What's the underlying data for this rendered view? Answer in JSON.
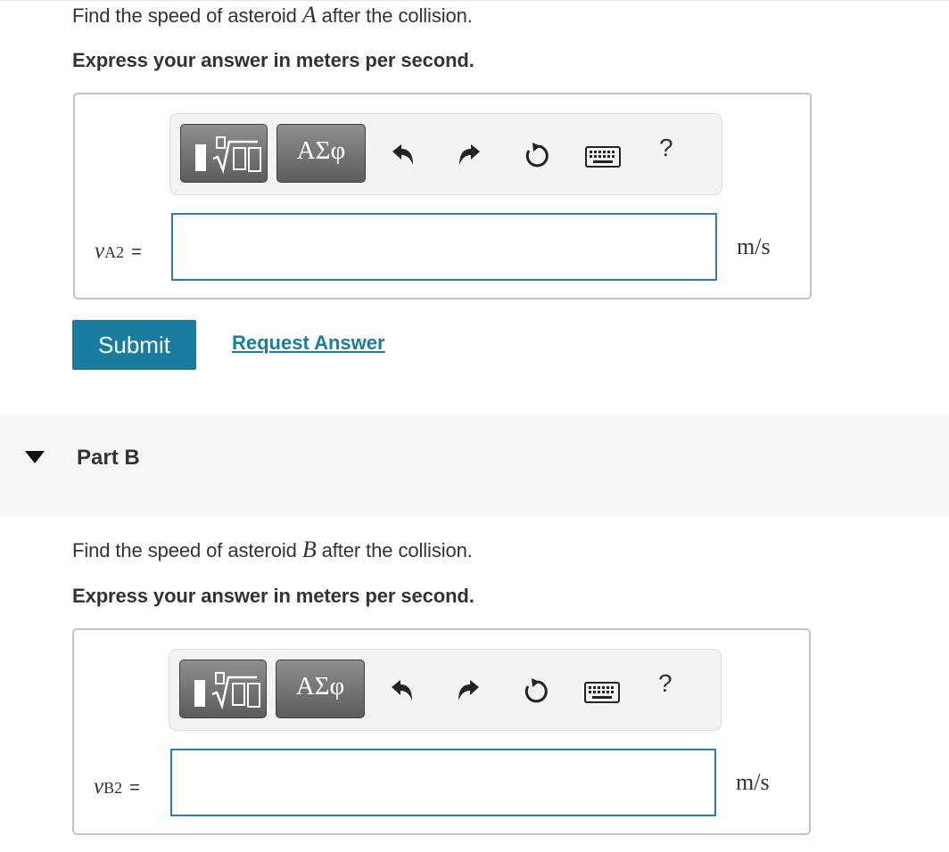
{
  "partA": {
    "prompt_before": "Find the speed of asteroid ",
    "prompt_var": "A",
    "prompt_after": " after the collision.",
    "instruction": "Express your answer in meters per second.",
    "variable": {
      "symbol": "v",
      "subscript": "A2",
      "equals": "="
    },
    "input": {
      "value": "",
      "placeholder": ""
    },
    "unit": "m/s",
    "submit_label": "Submit",
    "request_label": "Request Answer"
  },
  "toolbar": {
    "symbols_label": "ΑΣφ",
    "help_label": "?",
    "icons": [
      "templates-icon",
      "undo-icon",
      "redo-icon",
      "reset-icon",
      "keyboard-icon",
      "help-icon"
    ]
  },
  "partB_header": {
    "title": "Part B",
    "toggle_icon": "triangle-down-icon"
  },
  "partB": {
    "prompt_before": "Find the speed of asteroid ",
    "prompt_var": "B",
    "prompt_after": " after the collision.",
    "instruction": "Express your answer in meters per second.",
    "variable": {
      "symbol": "v",
      "subscript": "B2",
      "equals": "="
    },
    "input": {
      "value": "",
      "placeholder": ""
    },
    "unit": "m/s"
  },
  "colors": {
    "accent": "#1a7da0",
    "input_border": "#2b7ea4",
    "part_header_bg": "#f7f7f7"
  }
}
